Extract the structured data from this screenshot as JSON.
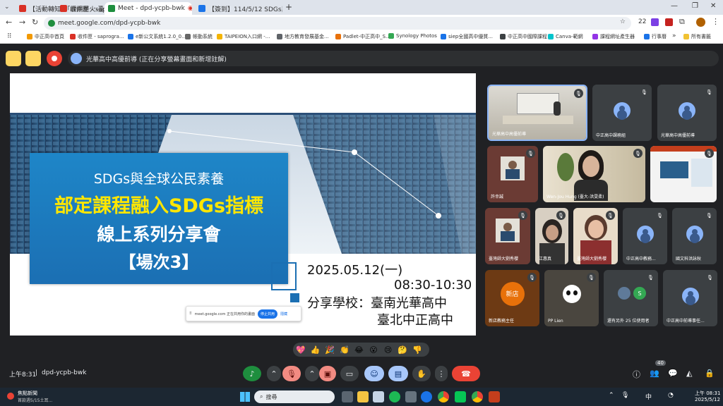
{
  "tabs": [
    {
      "label": "【活動轉知】「課綱薪火-臺北",
      "icon_color": "#d93025"
    },
    {
      "label": "收件匣 - saprogra",
      "icon_color": "#d93025"
    },
    {
      "label": "Meet - dpd-ycpb-bwk",
      "icon_color": "#1e8e3e"
    },
    {
      "label": "【簽到】114/5/12 SDGs與全",
      "icon_color": "#1a73e8"
    }
  ],
  "new_tab": "+",
  "url": "meet.google.com/dpd-ycpb-bwk",
  "profile_count": "22",
  "bookmarks": [
    "中正高中首頁",
    "收件匣 - saprogra...",
    "e新公文系統1.2.0_0...",
    "帳動系統",
    "TAIPEION入口網 -...",
    "地方教育發展基金...",
    "Padlet-中正高中_S...",
    "Synology Photos",
    "siep全國高中優質...",
    "中正高中國際課程",
    "Canva-範網",
    "課程網址產生器",
    "行事曆"
  ],
  "all_bookmarks": "所有書籤",
  "presenter_bar": "光華高中高優前導 (正在分享螢幕畫面和新增註解)",
  "slide": {
    "line1": "SDGs與全球公民素養",
    "line2": "部定課程融入SDGs指標",
    "line3": "線上系列分享會",
    "line4": "【場次3】",
    "date": "2025.05.12(一)",
    "time": "08:30-10:30",
    "school_label": "分享學校：臺南光華高中",
    "school2": "臺北中正高中",
    "popup_text": "meet.google.com 正在共用你的畫面",
    "popup_stop": "停止共用",
    "popup_hide": "隱藏"
  },
  "participants": [
    {
      "name": "光華高中高優前導"
    },
    {
      "name": "中正高中課務組"
    },
    {
      "name": "光華高中高優前導"
    },
    {
      "name": "許幸誠"
    },
    {
      "name": "Wen-Jou Hung (臺大-洪雯柔)"
    },
    {
      "name": ""
    },
    {
      "name": "臺灣師大劉秀櫻"
    },
    {
      "name": "江惠真"
    },
    {
      "name": "臺灣師大劉秀櫻"
    },
    {
      "name": "中正高中教務..."
    },
    {
      "name": "國文科洪詠秋"
    },
    {
      "name": "新店教務主任",
      "badge": "新店"
    },
    {
      "name": "PP Lien"
    },
    {
      "name": "還有另外 25 位使用者",
      "badge": "S"
    },
    {
      "name": "中正高中前導事任..."
    }
  ],
  "reactions": [
    "💖",
    "👍",
    "🎉",
    "👏",
    "😂",
    "😮",
    "😢",
    "🤔",
    "👎"
  ],
  "meeting_time": "上午8:31",
  "meeting_code": "dpd-ycpb-bwk",
  "people_count": "40",
  "taskbar": {
    "news_title": "焦點新聞",
    "news_sub": "首款週5/15土耳...",
    "search": "搜尋",
    "ime": "中",
    "clock_time": "上午 08:31",
    "clock_date": "2025/5/12"
  },
  "colors": {
    "accent": "#8ab4f8",
    "red": "#ea4335",
    "yellow": "#fdd663",
    "slide_title": "#ffe600"
  }
}
